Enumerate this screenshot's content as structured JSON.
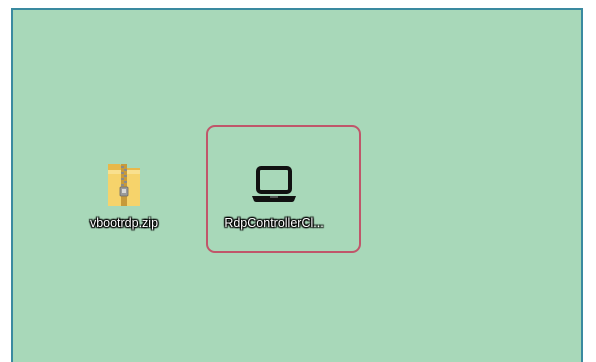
{
  "desktop": {
    "background_color": "#a8d8b9",
    "border_color": "#3a8aa0",
    "icons": [
      {
        "label": "vbootrdp.zip",
        "icon": "zip-folder-icon"
      },
      {
        "label": "RdpControllerCl...",
        "icon": "laptop-icon"
      }
    ],
    "highlight_color": "#c0566a"
  }
}
